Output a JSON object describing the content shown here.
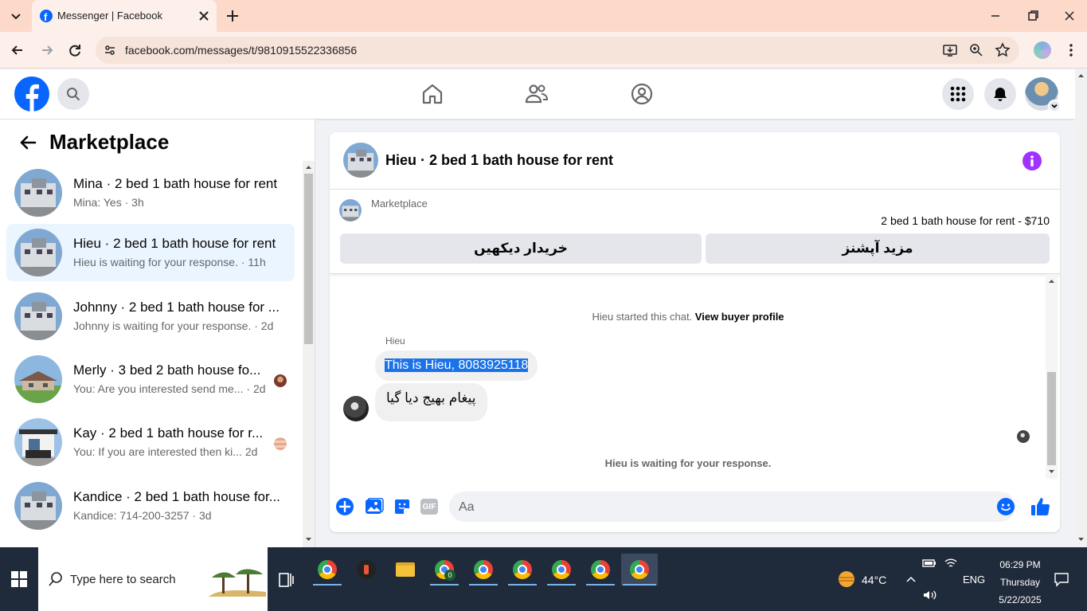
{
  "browser": {
    "tab_title": "Messenger | Facebook",
    "url": "facebook.com/messages/t/9810915522336856"
  },
  "colors": {
    "fb_blue": "#0866ff",
    "accent_purple": "#a033ff",
    "selection": "#1a73e8"
  },
  "sidebar": {
    "back_icon": "arrow-left-icon",
    "title": "Marketplace",
    "conversations": [
      {
        "name": "Mina · 2 bed 1 bath house for rent",
        "preview": "Mina: Yes · 3h",
        "active": false
      },
      {
        "name": "Hieu · 2 bed 1 bath house for rent",
        "preview": "Hieu is waiting for your response. · 11h",
        "active": true
      },
      {
        "name": "Johnny · 2 bed 1 bath house for ...",
        "preview": "Johnny is waiting for your response. · 2d",
        "active": false
      },
      {
        "name": "Merly · 3 bed 2 bath house fo...",
        "preview": "You: Are you interested send me... · 2d",
        "active": false
      },
      {
        "name": "Kay · 2 bed 1 bath house for r...",
        "preview": "You: If you are interested then ki...  2d",
        "active": false
      },
      {
        "name": "Kandice · 2 bed 1 bath house for...",
        "preview": "Kandice: 714-200-3257 · 3d",
        "active": false
      }
    ]
  },
  "chat": {
    "header_title": "Hieu · 2 bed 1 bath house for rent",
    "marketplace_label": "Marketplace",
    "listing": "2 bed 1 bath house for rent - $710",
    "btn_view_buyer": "خریدار دیکھیں",
    "btn_more_options": "مزید آپشنز",
    "started_text": "Hieu started this chat.",
    "view_buyer_profile": "View buyer profile",
    "sender_name": "Hieu",
    "message_1": "This is Hieu, 8083925118",
    "message_2": "پیغام بھیج دیا گیا",
    "waiting_text": "Hieu is waiting for your response.",
    "composer_placeholder": "Aa",
    "gif_label": "GIF"
  },
  "taskbar": {
    "search_placeholder": "Type here to search",
    "weather": "44°C",
    "language": "ENG",
    "time": "06:29 PM",
    "day": "Thursday",
    "date": "5/22/2025",
    "badge_count": "0"
  }
}
